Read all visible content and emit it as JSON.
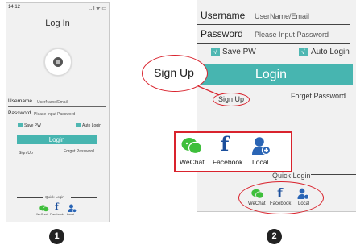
{
  "phone1": {
    "status_time": "14:12",
    "status_icons": "..ıl ᯤ ▭",
    "title": "Log In",
    "username_label": "Username",
    "username_placeholder": "UserName/Email",
    "password_label": "Password",
    "password_placeholder": "Please Input Password",
    "save_pw": "Save PW",
    "auto_login": "Auto Login",
    "login": "Login",
    "sign_up": "Sign Up",
    "forget_password": "Forget Password",
    "quick_login": "Quick Login",
    "quick_items": [
      "WeChat",
      "Facebook",
      "Local"
    ]
  },
  "phone2": {
    "username_label": "Username",
    "username_placeholder": "UserName/Email",
    "password_label": "Password",
    "password_placeholder": "Please Input Password",
    "save_pw": "Save PW",
    "auto_login": "Auto Login",
    "login": "Login",
    "sign_up": "Sign Up",
    "forget_password": "Forget Password",
    "quick_login": "Quick Login",
    "quick_items": [
      "WeChat",
      "Facebook",
      "Local"
    ],
    "check_mark": "√"
  },
  "callout": {
    "sign_up": "Sign Up",
    "zoom_items": [
      "WeChat",
      "Facebook",
      "Local"
    ],
    "zoom_partial_label": "ck Login"
  },
  "badges": [
    "1",
    "2"
  ],
  "colors": {
    "accent": "#47b5b0",
    "highlight": "#d9232d",
    "wechat": "#3fbf3c",
    "facebook": "#1b4f9c",
    "local": "#2a65b5"
  }
}
